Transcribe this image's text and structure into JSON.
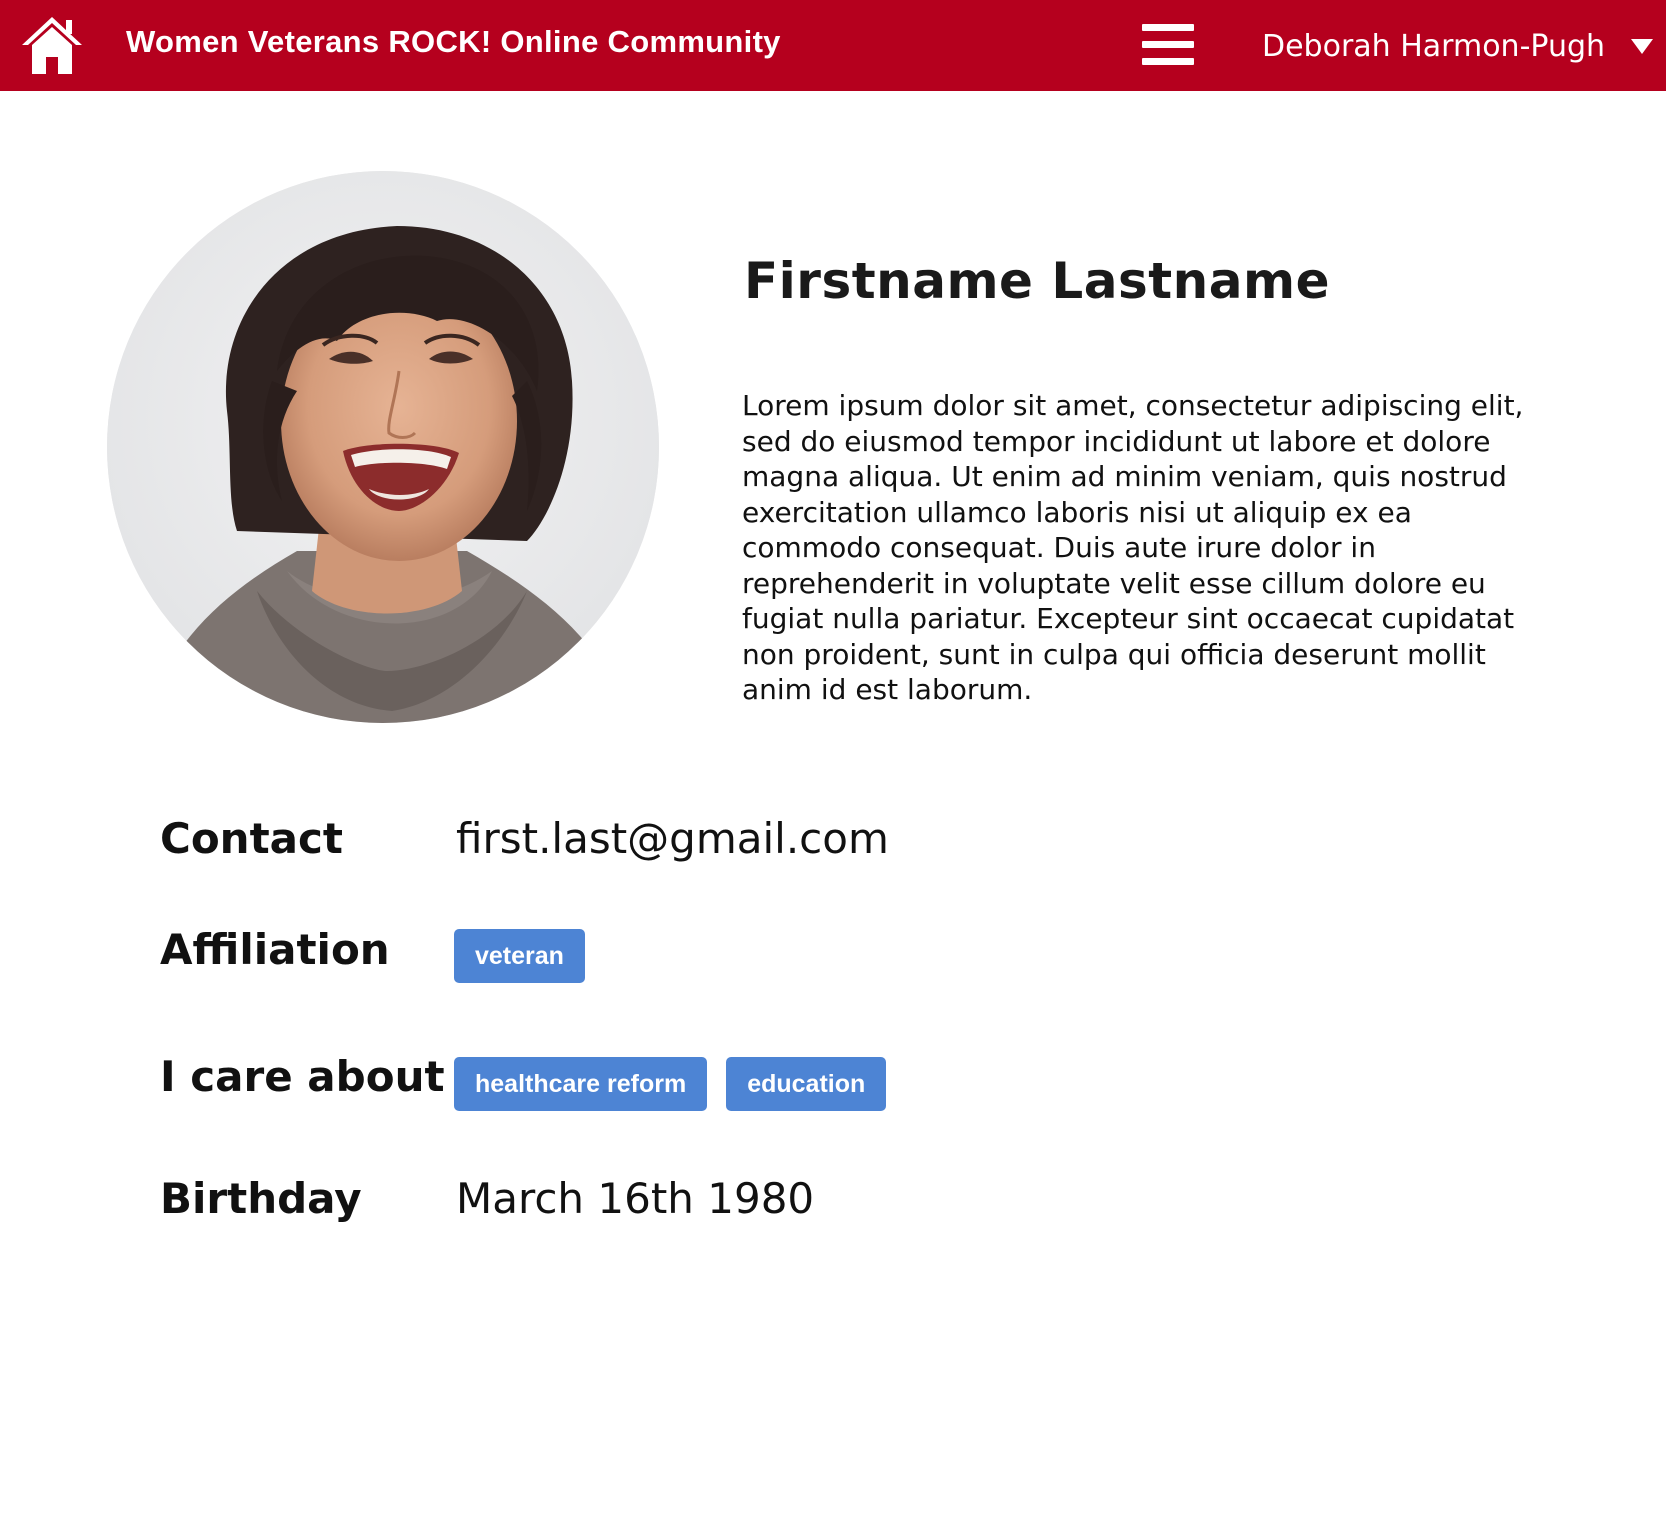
{
  "header": {
    "site_title": "Women Veterans ROCK! Online Community",
    "user_name": "Deborah Harmon-Pugh",
    "home_icon": "home-icon",
    "menu_icon": "hamburger-icon",
    "dropdown_icon": "caret-down-icon",
    "bar_color": "#b5001e"
  },
  "profile": {
    "name": "Firstname Lastname",
    "bio": "Lorem ipsum dolor sit amet, consectetur adipiscing elit, sed do eiusmod tempor incididunt ut labore et dolore magna aliqua. Ut enim ad minim veniam, quis nostrud exercitation ullamco laboris nisi ut aliquip ex ea commodo consequat. Duis aute irure dolor in reprehenderit in voluptate velit esse cillum dolore eu fugiat nulla pariatur. Excepteur sint occaecat cupidatat non proident, sunt in culpa qui officia deserunt mollit anim id est laborum."
  },
  "details": {
    "contact": {
      "label": "Contact",
      "value": "first.last@gmail.com"
    },
    "affiliation": {
      "label": "Affiliation",
      "tags": [
        "veteran"
      ]
    },
    "interests": {
      "label": "I care about",
      "tags": [
        "healthcare reform",
        "education"
      ]
    },
    "birthday": {
      "label": "Birthday",
      "value": "March 16th 1980"
    }
  },
  "tag_color": "#4d84d4"
}
